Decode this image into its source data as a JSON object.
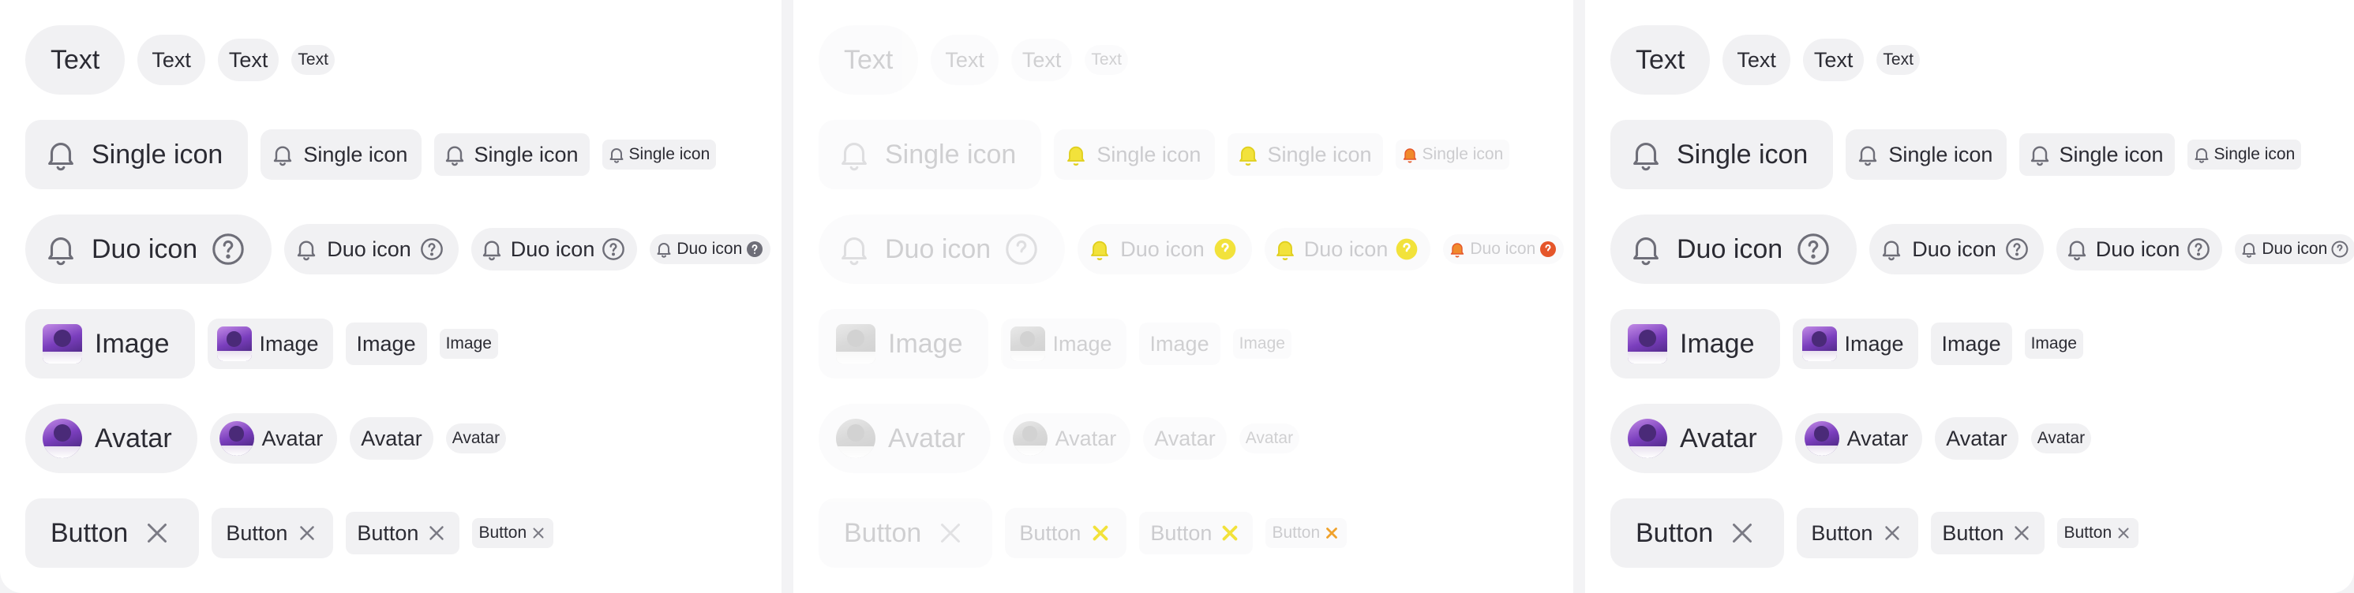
{
  "colors": {
    "chip_bg": "#f1f1f3",
    "text": "#2b2b33",
    "icon": "#6e6e78",
    "yellow": "#f2e23b",
    "orange_red": "#e5562a"
  },
  "icons": {
    "bell": "bell-icon",
    "help": "help-circle-icon",
    "close": "close-icon",
    "image": "image-thumbnail",
    "avatar": "avatar"
  },
  "labels": {
    "text": "Text",
    "single_icon": "Single icon",
    "duo_icon": "Duo icon",
    "image": "Image",
    "avatar": "Avatar",
    "button": "Button"
  }
}
